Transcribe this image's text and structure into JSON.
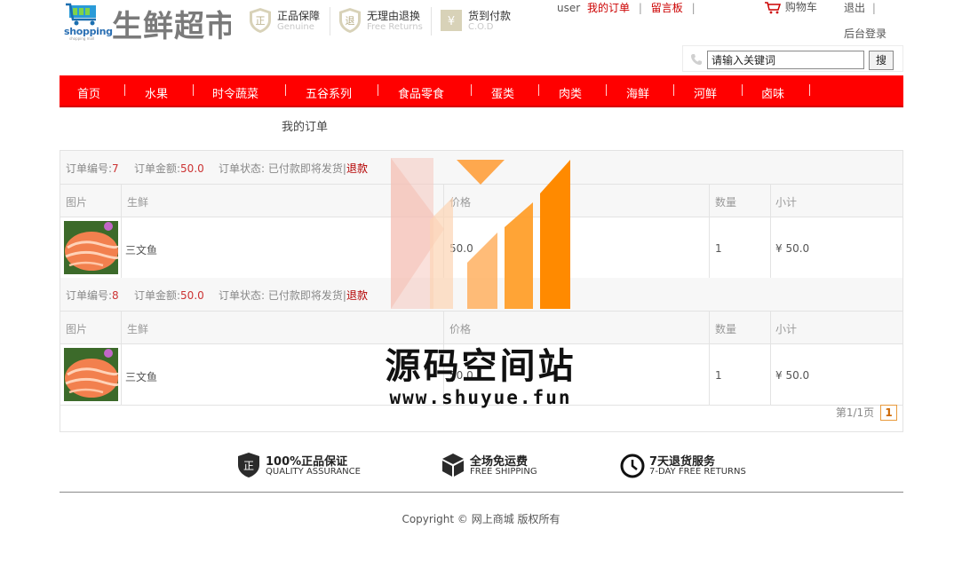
{
  "header": {
    "logo_word": "shopping",
    "logo_sub": "shopping mall",
    "site_title": "生鲜超市",
    "promos": [
      {
        "title": "正品保障",
        "subtitle": "Genuine",
        "glyph": "正",
        "icon": "genuine-shield-icon"
      },
      {
        "title": "无理由退换",
        "subtitle": "Free Returns",
        "glyph": "退",
        "icon": "returns-shield-icon"
      },
      {
        "title": "货到付款",
        "subtitle": "C.O.D",
        "glyph": "¥",
        "icon": "cod-icon"
      }
    ],
    "user_name": "user",
    "my_orders": "我的订单",
    "guestbook": "留言板",
    "cart": "购物车",
    "logout": "退出",
    "admin_login": "后台登录",
    "separator": "|"
  },
  "search": {
    "value": "请输入关键词",
    "button": "搜"
  },
  "nav": {
    "items": [
      "首页",
      "水果",
      "时令蔬菜",
      "五谷系列",
      "食品零食",
      "蛋类",
      "肉类",
      "海鲜",
      "河鲜",
      "卤味"
    ]
  },
  "page_title": "我的订单",
  "orders": {
    "labels": {
      "order_no": "订单编号:",
      "amount": "订单金额:",
      "status": "订单状态:",
      "refund": "退款",
      "col_image": "图片",
      "col_product": "生鲜",
      "col_price": "价格",
      "col_qty": "数量",
      "col_subtotal": "小计"
    },
    "list": [
      {
        "order_no": "7",
        "amount": "50.0",
        "status": "已付款即将发货",
        "item": {
          "name": "三文鱼",
          "price": "50.0",
          "qty": "1",
          "subtotal": "¥ 50.0"
        }
      },
      {
        "order_no": "8",
        "amount": "50.0",
        "status": "已付款即将发货",
        "item": {
          "name": "三文鱼",
          "price": "50.0",
          "qty": "1",
          "subtotal": "¥ 50.0"
        }
      }
    ],
    "pager_text": "第1/1页",
    "current_page": "1"
  },
  "watermark": {
    "title": "源码空间站",
    "url": "www.shuyue.fun"
  },
  "footer": {
    "services": [
      {
        "title": "100%正品保证",
        "subtitle": "QUALITY ASSURANCE",
        "icon": "quality-shield-icon"
      },
      {
        "title": "全场免运费",
        "subtitle": "FREE SHIPPING",
        "icon": "box-icon"
      },
      {
        "title": "7天退货服务",
        "subtitle": "7-DAY FREE RETURNS",
        "icon": "clock-icon"
      }
    ],
    "copyright": "Copyright © 网上商城 版权所有"
  },
  "colors": {
    "nav_red": "#ff0000",
    "link_red": "#cc0000",
    "watermark_orange": "#ff8a00",
    "pager_orange": "#e89a3c"
  }
}
